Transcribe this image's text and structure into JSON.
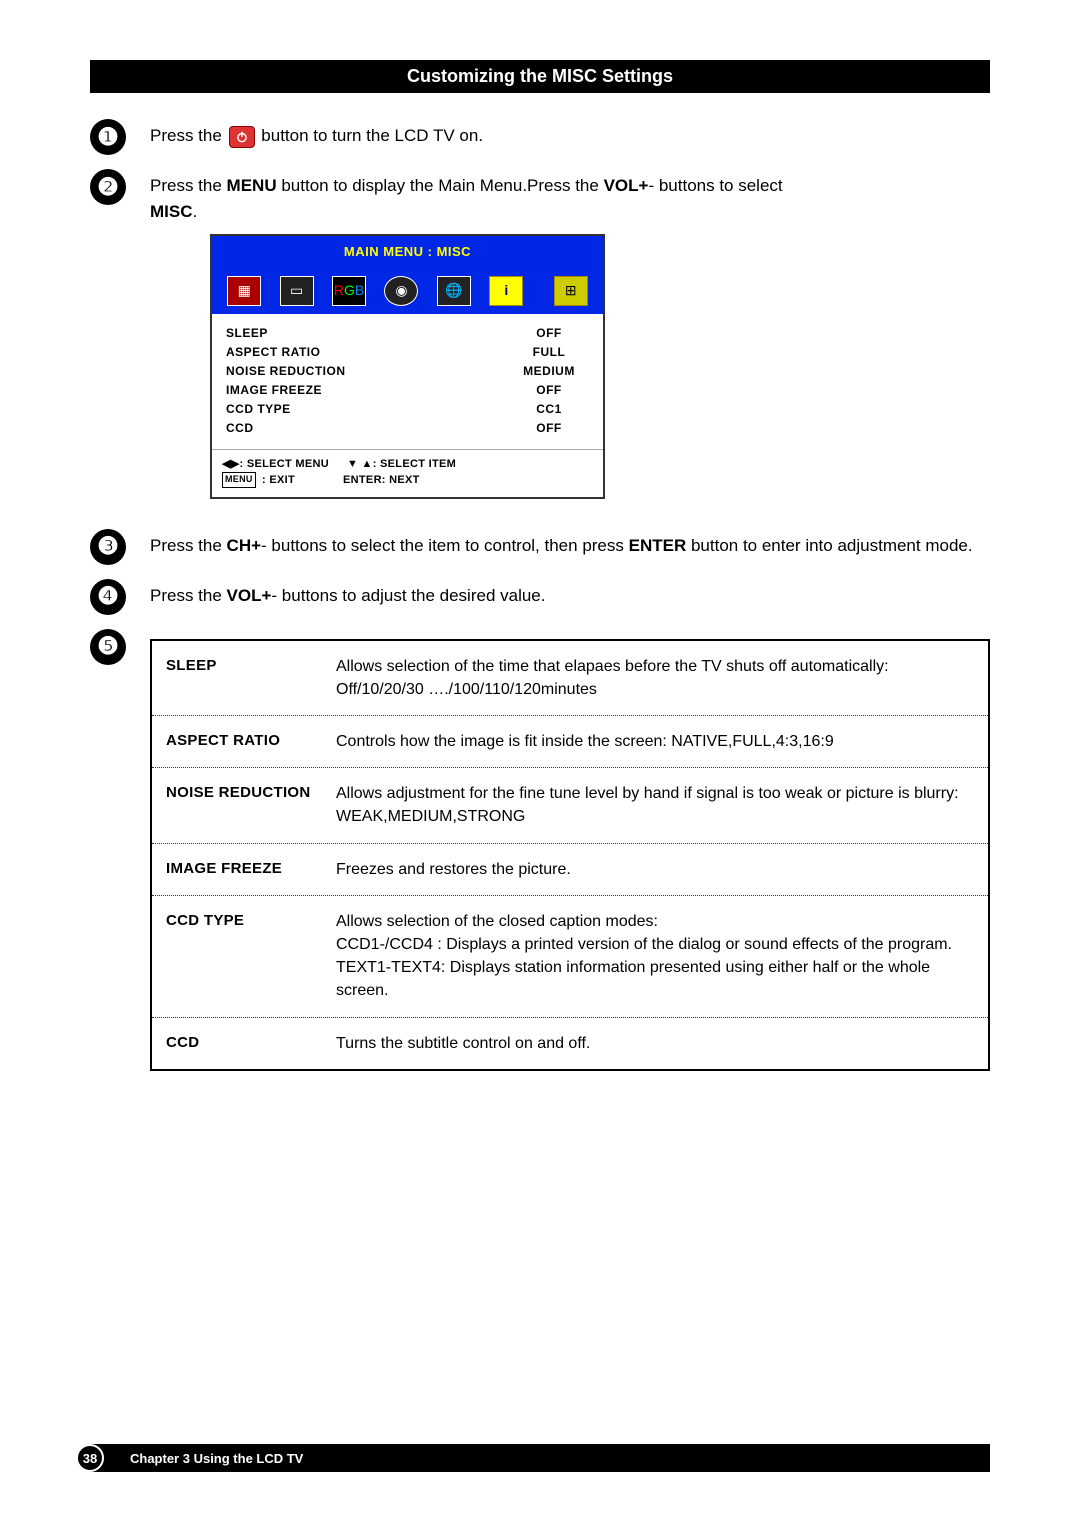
{
  "title": "Customizing the MISC Settings",
  "steps": {
    "s1a": "Press the ",
    "s1b": " button to turn the LCD TV on.",
    "s2a": "Press the ",
    "s2b": "MENU",
    "s2c": " button to display the Main Menu.Press the ",
    "s2d": "VOL+",
    "s2e": "- buttons to select ",
    "s2f": "MISC",
    "s2g": ".",
    "s3a": "Press the ",
    "s3b": "CH+",
    "s3c": "- buttons to select the item to control, then press ",
    "s3d": "ENTER",
    "s3e": " button to enter into adjustment mode.",
    "s4a": "Press the ",
    "s4b": "VOL+",
    "s4c": "- buttons to adjust the desired value."
  },
  "osd": {
    "heading": "MAIN MENU : MISC",
    "rows": [
      {
        "label": "SLEEP",
        "value": "OFF"
      },
      {
        "label": "ASPECT RATIO",
        "value": "FULL"
      },
      {
        "label": "NOISE REDUCTION",
        "value": "MEDIUM"
      },
      {
        "label": "IMAGE FREEZE",
        "value": "OFF"
      },
      {
        "label": "CCD TYPE",
        "value": "CC1"
      },
      {
        "label": "CCD",
        "value": "OFF"
      }
    ],
    "foot1a": "◀▶: SELECT MENU",
    "foot1b": "▼ ▲: SELECT ITEM",
    "foot2a_box": "MENU",
    "foot2a": " : EXIT",
    "foot2b": "ENTER: NEXT"
  },
  "defs": [
    {
      "label": "SLEEP",
      "desc": "Allows selection of the time that elapaes before the TV shuts off automatically: Off/10/20/30 …./100/110/120minutes"
    },
    {
      "label": "ASPECT RATIO",
      "desc": "Controls how the image is fit inside the screen: NATIVE,FULL,4:3,16:9"
    },
    {
      "label": "NOISE REDUCTION",
      "desc": "Allows adjustment for the fine tune level by hand if signal is too weak or picture is blurry: WEAK,MEDIUM,STRONG"
    },
    {
      "label": "IMAGE FREEZE",
      "desc": "Freezes and restores the picture."
    },
    {
      "label": "CCD TYPE",
      "desc": "Allows selection of the closed caption modes:\nCCD1-/CCD4 : Displays a printed version of the dialog or sound effects of the program.\nTEXT1-TEXT4: Displays station information presented using either half or the whole screen."
    },
    {
      "label": "CCD",
      "desc": "Turns the subtitle control on and off."
    }
  ],
  "footer": {
    "page": "38",
    "chapter": "Chapter 3 Using the LCD TV"
  }
}
